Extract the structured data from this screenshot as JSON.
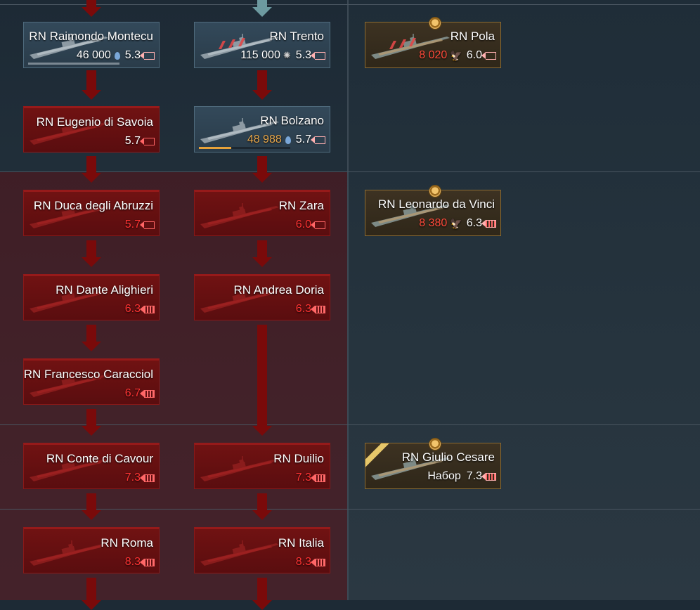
{
  "tree": {
    "col1": [
      {
        "name": "RN Raimondo Montecu",
        "cost": "46 000",
        "cost_type": "rp",
        "br": "5.3",
        "state": "researched",
        "progress": 1.0
      },
      {
        "name": "RN Eugenio di Savoia",
        "cost": "",
        "br": "5.7",
        "state": "locked"
      },
      {
        "name": "RN Duca degli Abruzzi",
        "cost": "",
        "br": "5.7",
        "state": "locked"
      },
      {
        "name": "RN Dante Alighieri",
        "cost": "",
        "br": "6.3",
        "state": "locked"
      },
      {
        "name": "RN Francesco Caracciol",
        "cost": "",
        "br": "6.7",
        "state": "locked"
      },
      {
        "name": "RN Conte di Cavour",
        "cost": "",
        "br": "7.3",
        "state": "locked"
      },
      {
        "name": "RN Roma",
        "cost": "",
        "br": "8.3",
        "state": "locked"
      }
    ],
    "col2": [
      {
        "name": "RN Trento",
        "cost": "115 000",
        "cost_type": "lion",
        "br": "5.3",
        "state": "researched"
      },
      {
        "name": "RN Bolzano",
        "cost": "48 988",
        "cost_type": "rp",
        "br": "5.7",
        "state": "researched",
        "progress": 0.35
      },
      {
        "name": "RN Zara",
        "cost": "",
        "br": "6.0",
        "state": "locked"
      },
      {
        "name": "RN Andrea Doria",
        "cost": "",
        "br": "6.3",
        "state": "locked"
      },
      {
        "name": "RN Duilio",
        "cost": "",
        "br": "7.3",
        "state": "locked"
      },
      {
        "name": "RN Italia",
        "cost": "",
        "br": "8.3",
        "state": "locked"
      }
    ],
    "premium": [
      {
        "name": "RN Pola",
        "cost": "8 020",
        "cost_type": "ge",
        "br": "6.0"
      },
      {
        "name": "RN Leonardo da Vinci",
        "cost": "8 380",
        "cost_type": "ge",
        "br": "6.3"
      },
      {
        "name": "RN Giulio Cesare",
        "cost": "Набор",
        "cost_type": "pack",
        "br": "7.3"
      }
    ]
  },
  "colors": {
    "locked": "#701212",
    "researched": "#33495a",
    "premium_border": "#8b6b32",
    "arrow_red": "#7a0a0a",
    "arrow_teal": "#6d9aa0",
    "ge_cost": "#ff4a3a",
    "rp_progress": "#e7a23a"
  },
  "icons": {
    "rp": "research-drop-icon",
    "lion": "silver-lion-icon",
    "ge": "golden-eagle-icon",
    "br": "battle-rating-icon"
  }
}
